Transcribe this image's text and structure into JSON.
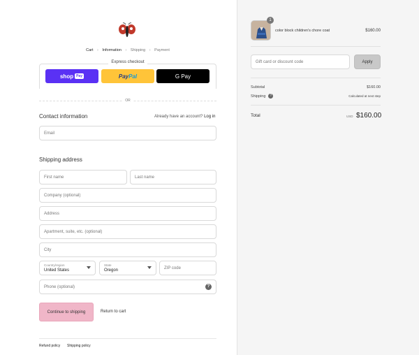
{
  "breadcrumb": [
    "Cart",
    "Information",
    "Shipping",
    "Payment"
  ],
  "express": {
    "title": "Express checkout",
    "shop_label": "shop",
    "shop_tag": "Pay",
    "paypal_a": "Pay",
    "paypal_b": "Pal",
    "gpay_label": "G Pay",
    "or_text": "OR"
  },
  "contact": {
    "heading": "Contact information",
    "have_account": "Already have an account?",
    "login": "Log in",
    "email_placeholder": "Email"
  },
  "shipping": {
    "heading": "Shipping address",
    "first_name": "First name",
    "last_name": "Last name",
    "company": "Company (optional)",
    "address": "Address",
    "apartment": "Apartment, suite, etc. (optional)",
    "city": "City",
    "country_label": "Country/region",
    "country_value": "United States",
    "state_label": "State",
    "state_value": "Oregon",
    "zip": "ZIP code",
    "phone": "Phone (optional)",
    "help_glyph": "?"
  },
  "actions": {
    "continue": "Continue to shipping",
    "return": "Return to cart"
  },
  "footer": {
    "refund": "Refund policy",
    "shipping": "Shipping policy"
  },
  "order": {
    "quantity": "1",
    "product_name": "color block children's chore coat",
    "product_price": "$160.00",
    "discount_placeholder": "Gift card or discount code",
    "apply": "Apply",
    "subtotal_label": "Subtotal",
    "subtotal_value": "$160.00",
    "shipping_label": "Shipping",
    "shipping_value": "Calculated at next step",
    "total_label": "Total",
    "total_currency": "USD",
    "total_value": "$160.00"
  },
  "colors": {
    "shop_pay": "#5a31f4",
    "paypal": "#ffc439",
    "continue_button": "#f0b6c8"
  }
}
